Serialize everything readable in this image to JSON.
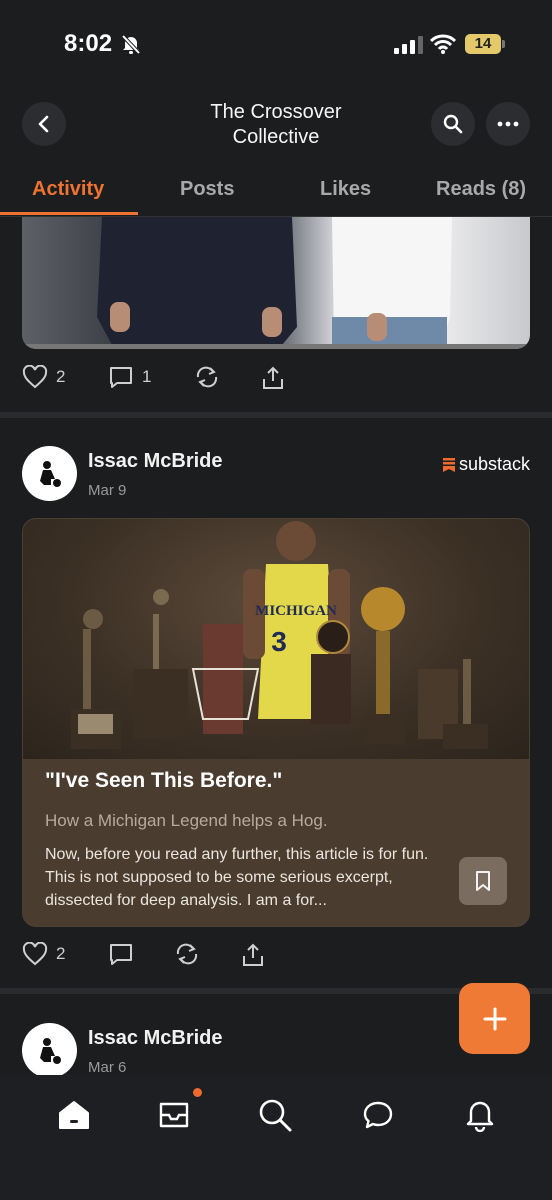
{
  "status_bar": {
    "time": "8:02",
    "battery": "14"
  },
  "header": {
    "title_line1": "The Crossover",
    "title_line2": "Collective"
  },
  "tabs": [
    {
      "label": "Activity",
      "active": true
    },
    {
      "label": "Posts",
      "active": false
    },
    {
      "label": "Likes",
      "active": false
    },
    {
      "label": "Reads (8)",
      "active": false
    }
  ],
  "feed": {
    "first_post": {
      "likes": "2",
      "comments": "1"
    },
    "second_post": {
      "author": "Issac McBride",
      "date": "Mar 9",
      "publication": "substack",
      "card": {
        "title": "\"I've Seen This Before.\"",
        "subtitle": "How a Michigan Legend helps a Hog.",
        "excerpt": "Now, before you read any further, this article is for fun. This is not supposed to be some serious excerpt, dissected for deep analysis. I am a for...",
        "image_jersey_text": "MICHIGAN",
        "image_jersey_number": "3"
      },
      "likes": "2"
    },
    "third_post": {
      "author": "Issac McBride",
      "date": "Mar 6"
    }
  },
  "colors": {
    "accent": "#ee7330",
    "background": "#1c1d1f",
    "card": "#4a3c2e"
  }
}
